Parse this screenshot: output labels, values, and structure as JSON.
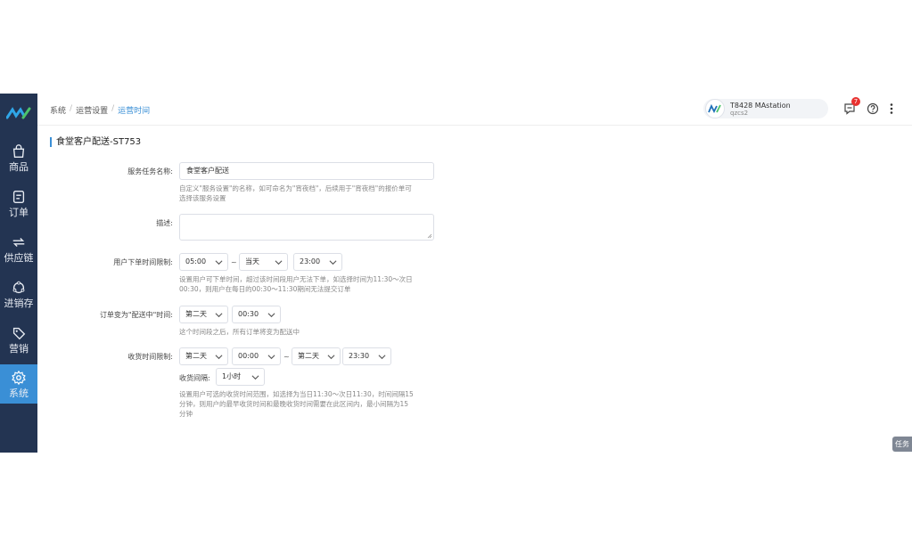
{
  "nav": {
    "logo": "logo",
    "items": [
      {
        "icon": "shopping-bag-icon",
        "label": "商品"
      },
      {
        "icon": "order-icon",
        "label": "订单"
      },
      {
        "icon": "supply-chain-icon",
        "label": "供应链"
      },
      {
        "icon": "inventory-icon",
        "label": "进销存"
      },
      {
        "icon": "tag-icon",
        "label": "营销"
      },
      {
        "icon": "gear-icon",
        "label": "系统",
        "active": true
      }
    ]
  },
  "breadcrumb": [
    "系统",
    "运营设置",
    "运营时间"
  ],
  "store": {
    "name": "T8428 MAstation",
    "sub": "qzcs2"
  },
  "header_icons": {
    "messages_badge": "7",
    "message_icon": "message-icon",
    "help_icon": "help-icon",
    "more_icon": "more-icon"
  },
  "page_title": "食堂客户配送-ST753",
  "form": {
    "service_name": {
      "label": "服务任务名称:",
      "value": "食堂客户配送",
      "help": [
        "自定义\"服务设置\"的名称，如可命名为\"宵夜档\"，后续用于\"宵夜档\"的报价单可",
        "选择该服务设置"
      ]
    },
    "description": {
      "label": "描述:",
      "value": ""
    },
    "order_time": {
      "label": "用户下单时间限制:",
      "start": "05:00",
      "tilde": "~",
      "day": "当天",
      "end": "23:00",
      "help": [
        "设置用户可下单时间，超过该时间段用户无法下单，如选择时间为11:30～次日",
        "00:30，则用户在每日的00:30～11:30期间无法提交订单"
      ]
    },
    "delivery_status": {
      "label": "订单变为\"配送中\"时间:",
      "day": "第二天",
      "time": "00:30",
      "help": "这个时间段之后，所有订单将变为配送中"
    },
    "receive_time": {
      "label": "收货时间限制:",
      "start_day": "第二天",
      "start_time": "00:00",
      "tilde": "~",
      "end_day": "第二天",
      "end_time": "23:30",
      "interval_label": "收货间隔:",
      "interval": "1小时",
      "help": [
        "设置用户可选的收货时间范围，如选择为当日11:30～次日11:30，时间间隔15",
        "分钟，则用户的最早收货时间和最晚收货时间需要在此区间内，最小间隔为15",
        "分钟"
      ]
    }
  },
  "task_button": "任务"
}
